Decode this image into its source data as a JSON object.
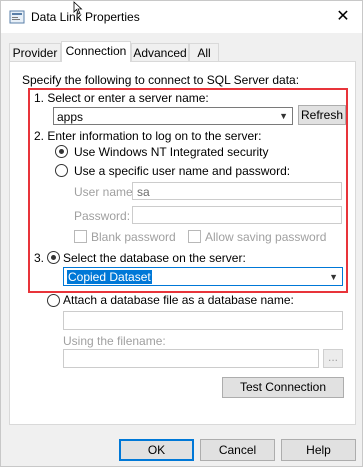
{
  "window": {
    "title": "Data Link Properties",
    "close_glyph": "✕"
  },
  "tabs": [
    {
      "label": "Provider"
    },
    {
      "label": "Connection"
    },
    {
      "label": "Advanced"
    },
    {
      "label": "All"
    }
  ],
  "connection": {
    "intro": "Specify the following to connect to SQL Server data:",
    "step1_label": "1. Select or enter a server name:",
    "server_value": "apps",
    "refresh_label": "Refresh",
    "step2_label": "2. Enter information to log on to the server:",
    "nt_security_label": "Use Windows NT Integrated security",
    "specific_user_label": "Use a specific user name and password:",
    "username_label": "User name:",
    "username_value": "sa",
    "password_label": "Password:",
    "password_value": "",
    "blank_password_label": "Blank password",
    "allow_saving_label": "Allow saving password",
    "step3_prefix": "3.",
    "select_db_label": "Select the database on the server:",
    "database_value": "Copied Dataset",
    "attach_label": "Attach a database file as a database name:",
    "attach_value": "",
    "using_filename_label": "Using the filename:",
    "filename_value": "",
    "browse_label": "...",
    "test_connection_label": "Test Connection"
  },
  "footer": {
    "ok_label": "OK",
    "cancel_label": "Cancel",
    "help_label": "Help"
  },
  "colors": {
    "highlight_box": "#e8343a",
    "selection": "#0078d7"
  }
}
